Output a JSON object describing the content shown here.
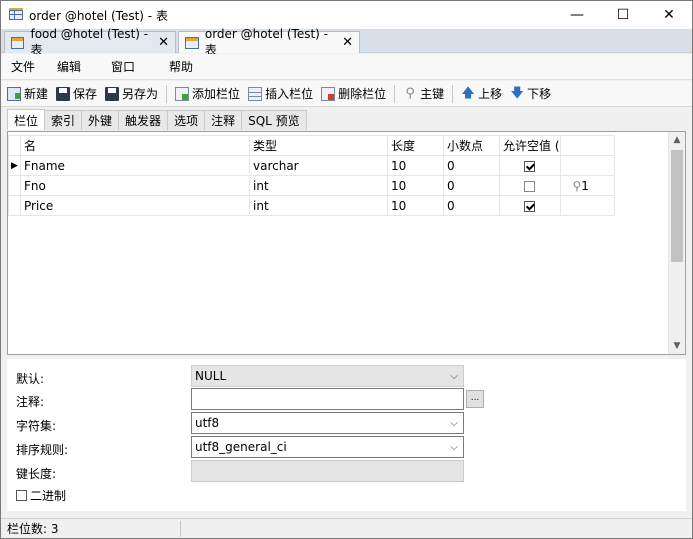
{
  "window": {
    "title": "order @hotel (Test) - 表"
  },
  "tabs": [
    {
      "label": "food @hotel (Test) - 表",
      "active": false
    },
    {
      "label": "order @hotel (Test) - 表",
      "active": true
    }
  ],
  "menu": [
    "文件",
    "编辑",
    "窗口",
    "帮助"
  ],
  "toolbar": {
    "new": "新建",
    "save": "保存",
    "save_as": "另存为",
    "add_column": "添加栏位",
    "insert_column": "插入栏位",
    "delete_column": "删除栏位",
    "primary_key": "主键",
    "move_up": "上移",
    "move_down": "下移"
  },
  "inner_tabs": [
    "栏位",
    "索引",
    "外键",
    "触发器",
    "选项",
    "注释",
    "SQL 预览"
  ],
  "grid": {
    "headers": [
      "名",
      "类型",
      "长度",
      "小数点",
      "允许空值 (",
      ""
    ],
    "rows": [
      {
        "name": "Fname",
        "type": "varchar",
        "length": "10",
        "decimals": "0",
        "nullable": true,
        "key": "",
        "current": true
      },
      {
        "name": "Fno",
        "type": "int",
        "length": "10",
        "decimals": "0",
        "nullable": false,
        "key": "1",
        "current": false
      },
      {
        "name": "Price",
        "type": "int",
        "length": "10",
        "decimals": "0",
        "nullable": true,
        "key": "",
        "current": false
      }
    ]
  },
  "properties": {
    "default_label": "默认:",
    "default_value": "NULL",
    "comment_label": "注释:",
    "comment_value": "",
    "charset_label": "字符集:",
    "charset_value": "utf8",
    "collation_label": "排序规则:",
    "collation_value": "utf8_general_ci",
    "key_length_label": "键长度:",
    "key_length_value": "",
    "binary_label": "二进制",
    "ellipsis": "..."
  },
  "status": {
    "field_count": "栏位数: 3"
  }
}
